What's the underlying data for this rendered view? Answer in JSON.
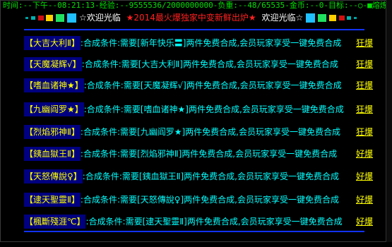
{
  "status_bar": {
    "text": "时间:--下午--08:21:13-经验:--9555536/2000000000-负重:--48/65535-金币:--0-目标:--○-■熔炼■○-0/0"
  },
  "banner": {
    "welcome_left": "☆欢迎光临",
    "headline": "★2014最火爆独家中变新鲜出炉★",
    "welcome_right": "欢迎光临☆",
    "colors": {
      "headline": "#ff2020",
      "welcome": "#ffffff"
    }
  },
  "recipes": [
    {
      "name": "【大吉大利Ⅱ】",
      "desc": ":合成条件:需要[新年快乐〓]两件免费合成,会员玩家享受一键免费合成",
      "grade": "狂爆"
    },
    {
      "name": "【天魔凝辉√】",
      "desc": ":合成条件:需要[大吉大利Ⅱ]两件免费合成,会员玩家享受一键免费合成",
      "grade": "狂爆"
    },
    {
      "name": "【嗜血诸神★】",
      "desc": ":合成条件:需要[天魔凝辉√]两件免费合成,会员玩家享受一键免费合成",
      "grade": "狂爆"
    },
    {
      "name": "【九幽阎罗★】",
      "desc": ":合成条件:需要[嗜血诸神★]两件免费合成,会员玩家享受一键免费合成",
      "grade": "狂爆"
    },
    {
      "name": "【烈焰邪神Ⅱ】",
      "desc": ":合成条件:需要[九幽阎罗★]两件免费合成,会员玩家享受一键免费合成",
      "grade": "狂爆"
    },
    {
      "name": "【銕血獄王Ⅱ】",
      "desc": ":合成条件:需要[烈焰邪神Ⅱ]两件免费合成,会员玩家享受一键免费合成",
      "grade": "好爆"
    },
    {
      "name": "【天怒傳說♀】",
      "desc": ":合成条件:需要[銕血獄王Ⅱ]两件免费合成,会员玩家享受一键免费合成",
      "grade": "好爆"
    },
    {
      "name": "【逮天聖靈Ⅱ】",
      "desc": ":合成条件:需要[天怒傳說♀]两件免费合成,会员玩家享受一键免费合成",
      "grade": "好爆"
    },
    {
      "name": "【楓斷殘涯℃】",
      "desc": ":合成条件:需要[逮天聖靈Ⅱ]两件免费合成,会员玩家享受一键免费合成",
      "grade": "好爆"
    }
  ],
  "bottom_ad": {
    "text": ""
  },
  "colors": {
    "name_bg": "#000080",
    "name_fg": "#ffff00",
    "desc": "#00ffff",
    "grade": "#ffff00",
    "rule": "#1133ff",
    "status": "#00e000"
  }
}
